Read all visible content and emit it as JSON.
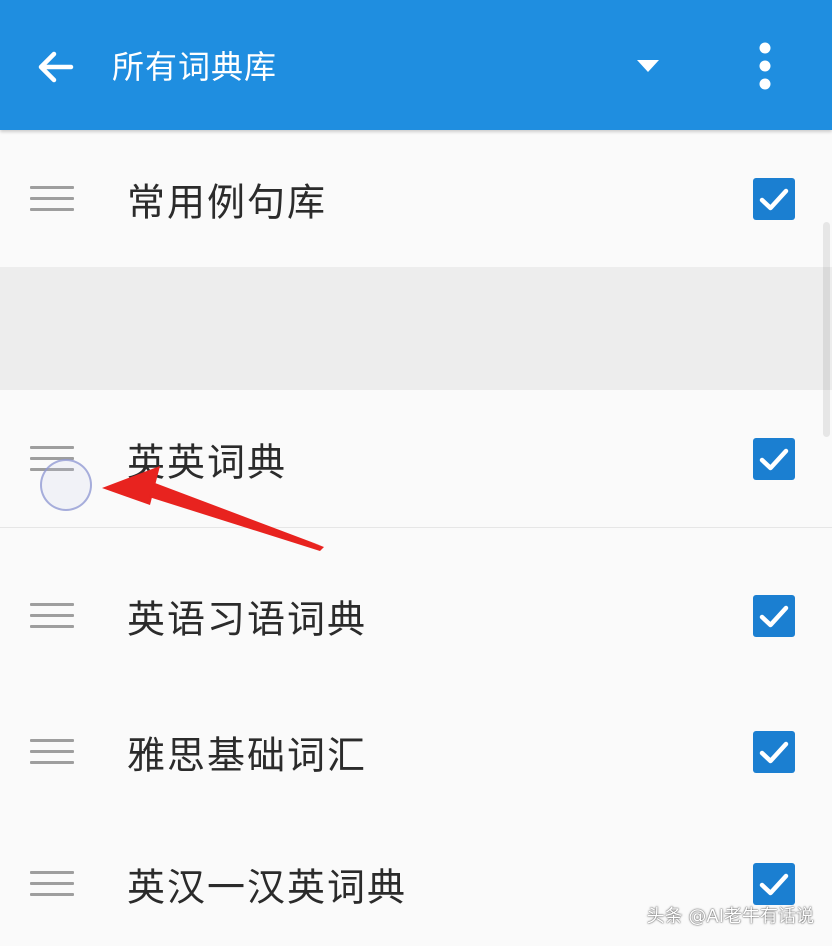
{
  "header": {
    "title": "所有词典库",
    "background_color": "#1f8ee0",
    "back_icon": "arrow-left-icon",
    "dropdown_icon": "caret-down-icon",
    "more_icon": "more-vertical-icon"
  },
  "list": {
    "items": [
      {
        "label": "常用例句库",
        "checked": true
      },
      {
        "label": "英英词典",
        "checked": true
      },
      {
        "label": "英语习语词典",
        "checked": true
      },
      {
        "label": "雅思基础词汇",
        "checked": true
      },
      {
        "label": "英汉一汉英词典",
        "checked": true
      }
    ],
    "drag_handle_icon": "drag-handle-icon",
    "checkbox_color": "#1b7fd1"
  },
  "annotation": {
    "arrow_color": "#e8231f"
  },
  "watermark": {
    "text": "头条 @AI老牛有话说"
  }
}
